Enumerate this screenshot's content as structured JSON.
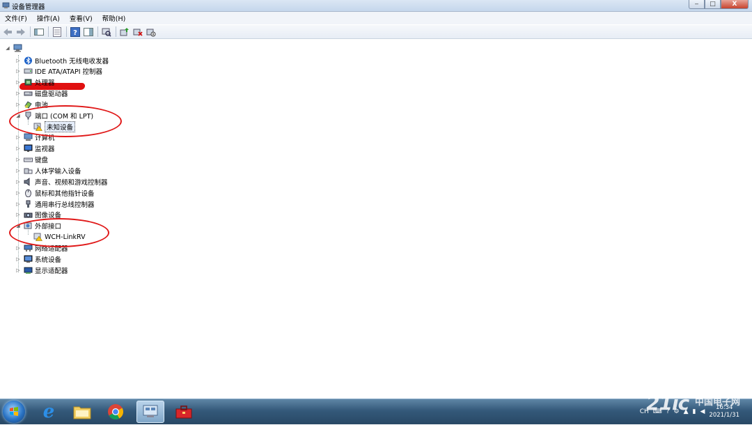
{
  "window": {
    "title": "设备管理器",
    "min": "‒",
    "max": "□",
    "close": "X"
  },
  "menu": [
    "文件(F)",
    "操作(A)",
    "查看(V)",
    "帮助(H)"
  ],
  "tree": {
    "nodes": [
      {
        "label": "Bluetooth 无线电收发器",
        "icon": "bluetooth-icon",
        "expander": "▷"
      },
      {
        "label": "IDE ATA/ATAPI 控制器",
        "icon": "ide-controller-icon",
        "expander": "▷"
      },
      {
        "label": "处理器",
        "icon": "processor-icon",
        "expander": "▷"
      },
      {
        "label": "磁盘驱动器",
        "icon": "disk-drive-icon",
        "expander": "▷"
      },
      {
        "label": "电池",
        "icon": "battery-icon",
        "expander": "▷"
      },
      {
        "label": "端口 (COM 和 LPT)",
        "icon": "port-icon",
        "expander": "◢"
      },
      {
        "label": "未知设备",
        "icon": "unknown-device-warning-icon",
        "expander": "",
        "child": true,
        "selected": true
      },
      {
        "label": "计算机",
        "icon": "computer-icon",
        "expander": "▷"
      },
      {
        "label": "监视器",
        "icon": "monitor-icon",
        "expander": "▷"
      },
      {
        "label": "键盘",
        "icon": "keyboard-icon",
        "expander": "▷"
      },
      {
        "label": "人体学输入设备",
        "icon": "hid-icon",
        "expander": "▷"
      },
      {
        "label": "声音、视频和游戏控制器",
        "icon": "sound-icon",
        "expander": "▷"
      },
      {
        "label": "鼠标和其他指针设备",
        "icon": "mouse-icon",
        "expander": "▷"
      },
      {
        "label": "通用串行总线控制器",
        "icon": "usb-icon",
        "expander": "▷"
      },
      {
        "label": "图像设备",
        "icon": "imaging-device-icon",
        "expander": "▷"
      },
      {
        "label": "外部接口",
        "icon": "external-interface-icon",
        "expander": "◢"
      },
      {
        "label": "WCH-LinkRV",
        "icon": "wch-device-warning-icon",
        "expander": "",
        "child": true
      },
      {
        "label": "网络适配器",
        "icon": "network-adapter-icon",
        "expander": "▷"
      },
      {
        "label": "系统设备",
        "icon": "system-device-icon",
        "expander": "▷"
      },
      {
        "label": "显示适配器",
        "icon": "display-adapter-icon",
        "expander": "▷"
      }
    ]
  },
  "taskbar": {
    "tray_lang": "CH",
    "tray_expand": "▲",
    "clock_time": "16:34",
    "clock_date": "2021/1/31"
  },
  "watermark": {
    "big": "21ic",
    "small": "中国电子网"
  },
  "colors": {
    "annotation": "#e01818",
    "taskbar": "#34597a"
  }
}
